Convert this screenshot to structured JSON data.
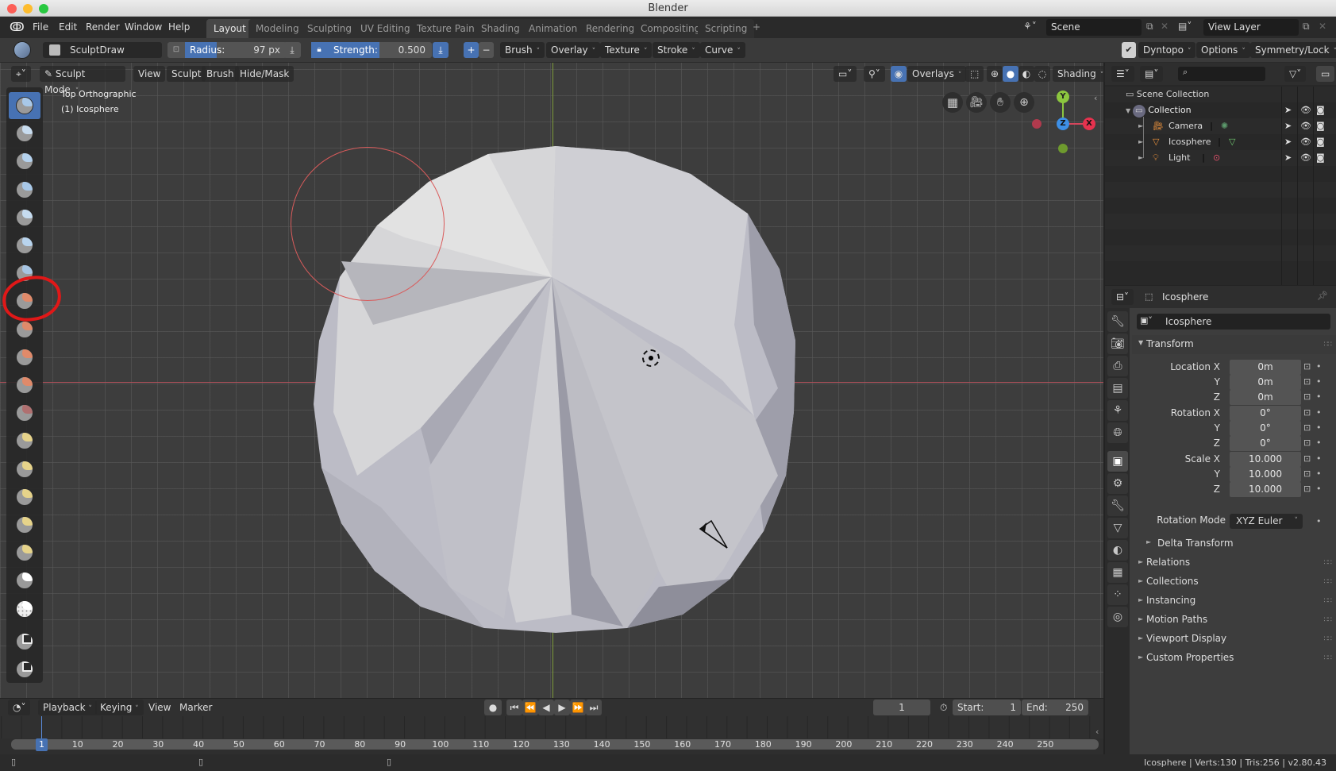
{
  "window": {
    "title": "Blender"
  },
  "menu": {
    "items": [
      "File",
      "Edit",
      "Render",
      "Window",
      "Help"
    ],
    "workspaces": [
      "Layout",
      "Modeling",
      "Sculpting",
      "UV Editing",
      "Texture Paint",
      "Shading",
      "Animation",
      "Rendering",
      "Compositing",
      "Scripting"
    ],
    "active_workspace": "Layout",
    "add_tab": "+",
    "scene": "Scene",
    "view_layer": "View Layer"
  },
  "toolheader": {
    "brush_name": "SculptDraw",
    "radius_label": "Radius:",
    "radius_value": "97 px",
    "strength_label": "Strength:",
    "strength_value": "0.500",
    "strength_fraction": 0.5,
    "plus": "+",
    "minus": "−",
    "menus": [
      "Brush",
      "Overlay",
      "Texture",
      "Stroke",
      "Curve"
    ],
    "dyntopo": "Dyntopo",
    "dyntopo_checked": true,
    "options": "Options",
    "symmetry": "Symmetry/Lock"
  },
  "viewport": {
    "mode": "Sculpt Mode",
    "menus": [
      "View",
      "Sculpt",
      "Brush",
      "Hide/Mask"
    ],
    "overlays": "Overlays",
    "shading": "Shading",
    "view_name": "Top Orthographic",
    "object_label": "(1) Icosphere",
    "gizmo": {
      "x": "X",
      "y": "Y",
      "z": "Z"
    },
    "colors": {
      "x_axis": "#d6465c",
      "y_axis": "#8cc63f",
      "z_axis": "#3d8fe6",
      "brush_circle": "#d95b5b"
    }
  },
  "tools": [
    "draw",
    "clay",
    "clay-strips",
    "layer",
    "inflate",
    "blob",
    "crease",
    "smooth",
    "flatten",
    "fill",
    "scrape",
    "pinch",
    "grab",
    "snake-hook",
    "thumb",
    "nudge",
    "rotate",
    "mask",
    "box-mask",
    "box-hide",
    "mesh-filter",
    "annotate"
  ],
  "outliner": {
    "search_placeholder": "",
    "scene_collection": "Scene Collection",
    "collection": "Collection",
    "items": [
      {
        "name": "Camera",
        "icon": "camera-icon",
        "data_icon": "camera-data-icon"
      },
      {
        "name": "Icosphere",
        "icon": "mesh-object-icon",
        "data_icon": "mesh-data-icon"
      },
      {
        "name": "Light",
        "icon": "light-icon",
        "data_icon": "light-data-icon"
      }
    ]
  },
  "properties": {
    "header_object": "Icosphere",
    "object_name": "Icosphere",
    "transform_label": "Transform",
    "rows": [
      {
        "label": "Location X",
        "value": "0m"
      },
      {
        "label": "Y",
        "value": "0m"
      },
      {
        "label": "Z",
        "value": "0m"
      },
      {
        "label": "Rotation X",
        "value": "0°"
      },
      {
        "label": "Y",
        "value": "0°"
      },
      {
        "label": "Z",
        "value": "0°"
      },
      {
        "label": "Scale X",
        "value": "10.000"
      },
      {
        "label": "Y",
        "value": "10.000"
      },
      {
        "label": "Z",
        "value": "10.000"
      }
    ],
    "rotation_mode_label": "Rotation Mode",
    "rotation_mode_value": "XYZ Euler",
    "delta_transform": "Delta Transform",
    "panels": [
      "Relations",
      "Collections",
      "Instancing",
      "Motion Paths",
      "Viewport Display",
      "Custom Properties"
    ]
  },
  "timeline": {
    "menus": [
      "Playback",
      "Keying",
      "View",
      "Marker"
    ],
    "current_frame": "1",
    "start_label": "Start:",
    "start": "1",
    "end_label": "End:",
    "end": "250",
    "ticks": [
      "10",
      "20",
      "30",
      "40",
      "50",
      "60",
      "70",
      "80",
      "90",
      "100",
      "110",
      "120",
      "130",
      "140",
      "150",
      "160",
      "170",
      "180",
      "190",
      "200",
      "210",
      "220",
      "230",
      "240",
      "250"
    ],
    "playhead": "1"
  },
  "status": {
    "text": "Icosphere | Verts:130 | Tris:256 | v2.80.43"
  }
}
